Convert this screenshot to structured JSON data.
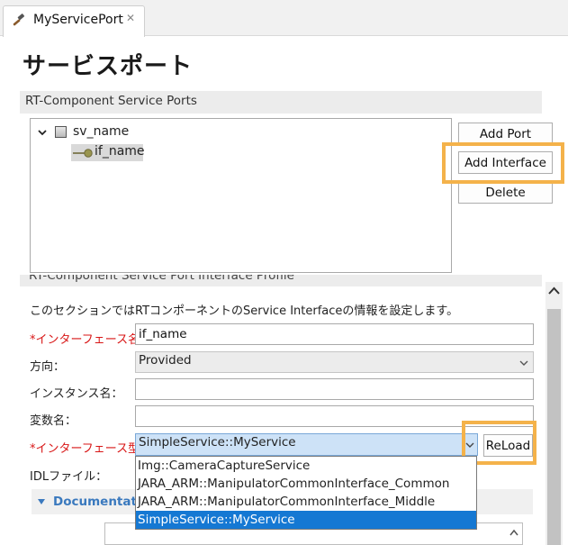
{
  "tab": {
    "title": "MyServicePort",
    "icon": "hammer-icon",
    "close_glyph": "✕"
  },
  "page_title": "サービスポート",
  "ports_section": {
    "title": "RT-Component Service Ports",
    "tree": {
      "port_name": "sv_name",
      "interface_name": "if_name"
    },
    "buttons": {
      "add_port": "Add Port",
      "add_interface": "Add Interface",
      "delete": "Delete"
    }
  },
  "profile_section": {
    "title": "RT-Component Service Port Interface Profile",
    "description": "このセクションではRTコンポーネントのService Interfaceの情報を設定します。",
    "fields": {
      "interface_name": {
        "label": "*インターフェース名：",
        "value": "if_name"
      },
      "direction": {
        "label": "方向：",
        "value": "Provided"
      },
      "instance_name": {
        "label": "インスタンス名：",
        "value": ""
      },
      "variable_name": {
        "label": "変数名：",
        "value": ""
      },
      "interface_type": {
        "label": "*インターフェース型：",
        "value": "SimpleService::MyService",
        "options": [
          "Img::CameraCaptureService",
          "JARA_ARM::ManipulatorCommonInterface_Common",
          "JARA_ARM::ManipulatorCommonInterface_Middle",
          "SimpleService::MyService"
        ],
        "selected_index": 3
      },
      "idl_file": {
        "label": "IDLファイル："
      }
    },
    "reload_button": "ReLoad",
    "documentation_label": "Documentation"
  },
  "colors": {
    "highlight": "#f4b24a",
    "required": "#d81616",
    "selected": "#1578d3",
    "link": "#3a79be"
  }
}
